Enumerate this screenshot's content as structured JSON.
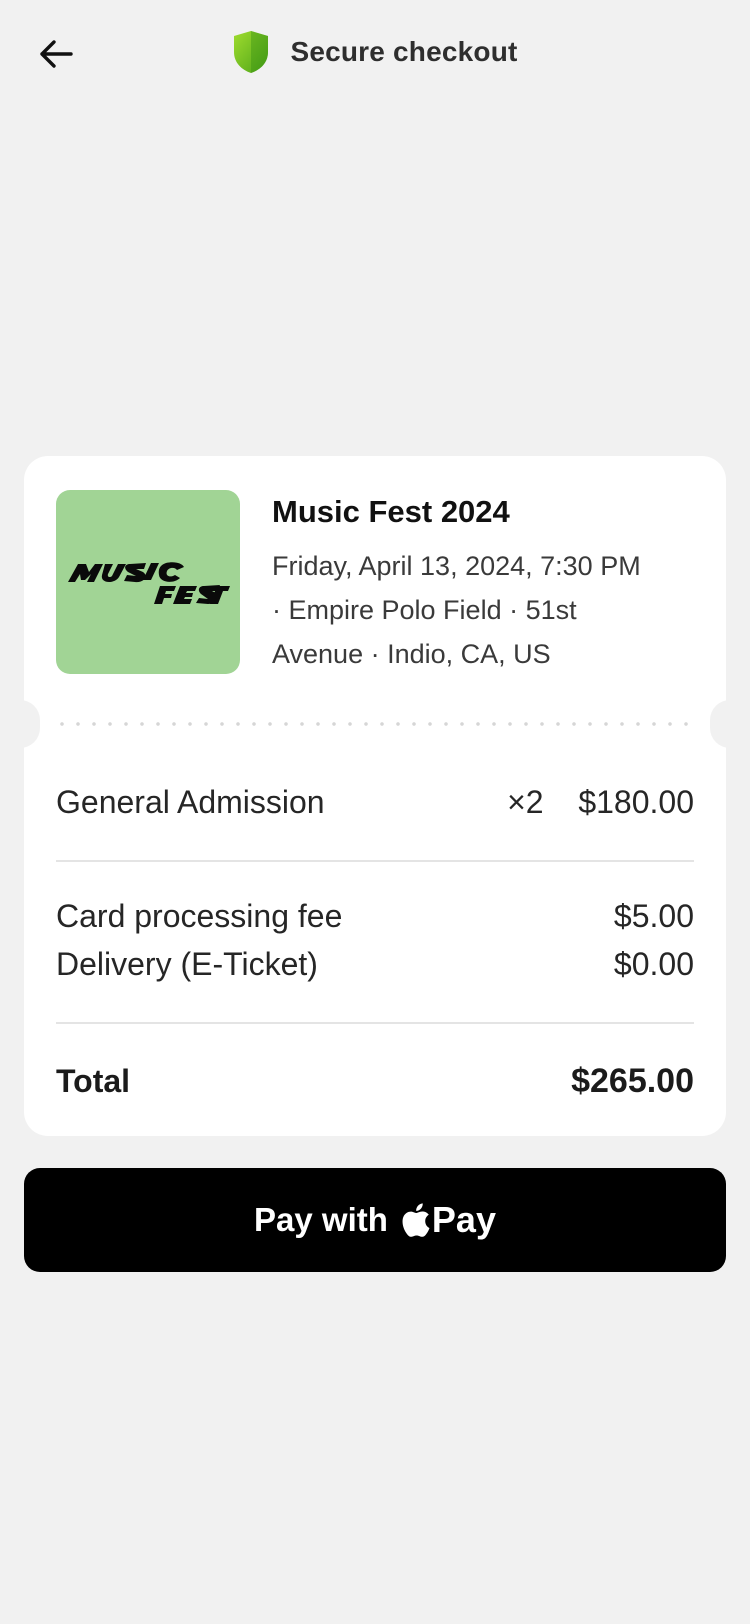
{
  "header": {
    "title": "Secure checkout",
    "back_icon": "arrow-left-icon",
    "shield_icon": "shield-icon",
    "shield_color": "#66bb22"
  },
  "event": {
    "logo_text": "MUSIC FEST",
    "logo_bg": "#a1d495",
    "title": "Music Fest 2024",
    "meta_line1": "Friday, April 13, 2024, 7:30 PM",
    "meta_line2": "· Empire Polo Field · 51st",
    "meta_line3": "Avenue · Indio, CA, US"
  },
  "items": [
    {
      "label": "General Admission",
      "qty": "×2",
      "amount": "$180.00"
    }
  ],
  "fees": [
    {
      "label": "Card processing fee",
      "amount": "$5.00"
    },
    {
      "label": "Delivery (E-Ticket)",
      "amount": "$0.00"
    }
  ],
  "total": {
    "label": "Total",
    "amount": "$265.00"
  },
  "pay_button": {
    "label": "Pay with",
    "brand_icon": "apple-logo-icon",
    "brand_text": "Pay",
    "bg": "#000000"
  }
}
